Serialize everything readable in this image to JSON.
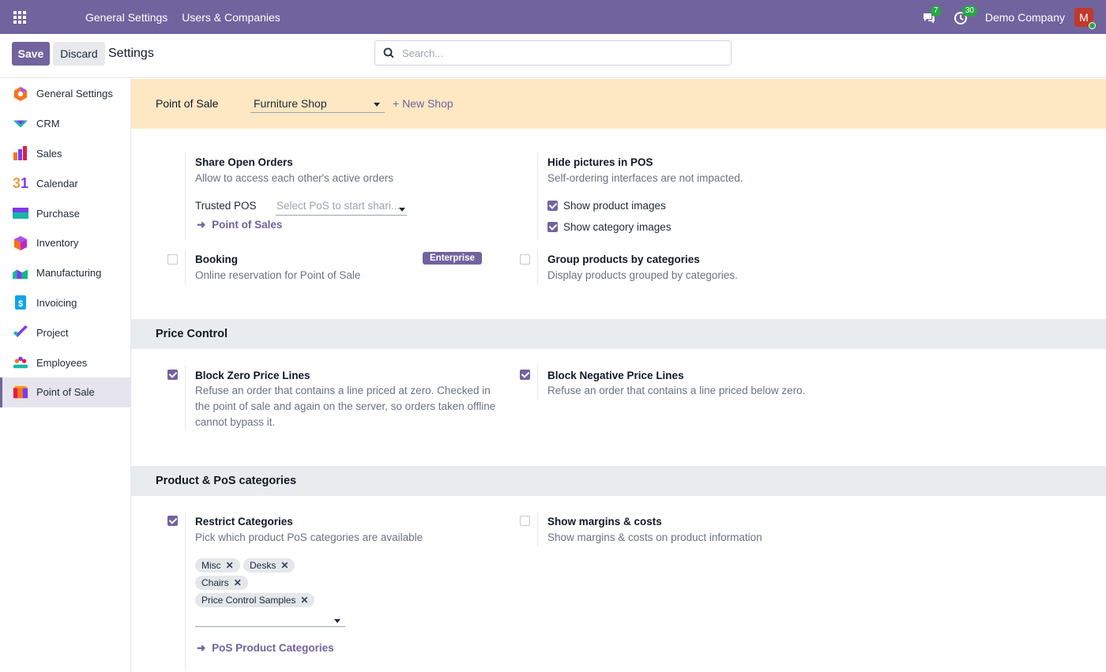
{
  "topbar": {
    "menu": [
      "General Settings",
      "Users & Companies"
    ],
    "messages_count": "7",
    "activities_count": "30",
    "company": "Demo Company",
    "avatar_letter": "M"
  },
  "control_panel": {
    "save_label": "Save",
    "discard_label": "Discard",
    "title": "Settings",
    "search_placeholder": "Search..."
  },
  "sidebar": {
    "items": [
      {
        "label": "General Settings",
        "icon": "general-settings-icon"
      },
      {
        "label": "CRM",
        "icon": "crm-icon"
      },
      {
        "label": "Sales",
        "icon": "sales-icon"
      },
      {
        "label": "Calendar",
        "icon": "calendar-icon"
      },
      {
        "label": "Purchase",
        "icon": "purchase-icon"
      },
      {
        "label": "Inventory",
        "icon": "inventory-icon"
      },
      {
        "label": "Manufacturing",
        "icon": "manufacturing-icon"
      },
      {
        "label": "Invoicing",
        "icon": "invoicing-icon"
      },
      {
        "label": "Project",
        "icon": "project-icon"
      },
      {
        "label": "Employees",
        "icon": "employees-icon"
      },
      {
        "label": "Point of Sale",
        "icon": "point-of-sale-icon"
      }
    ],
    "active_index": 10
  },
  "shop_bar": {
    "label": "Point of Sale",
    "selected_shop": "Furniture Shop",
    "new_shop": "+ New Shop"
  },
  "settings": {
    "share_open_orders": {
      "title": "Share Open Orders",
      "desc": "Allow to access each other's active orders",
      "trusted_label": "Trusted POS",
      "trusted_placeholder": "Select PoS to start shari...",
      "link": "Point of Sales"
    },
    "hide_pictures": {
      "title": "Hide pictures in POS",
      "desc": "Self-ordering interfaces are not impacted.",
      "option1": "Show product images",
      "option1_checked": true,
      "option2": "Show category images",
      "option2_checked": true
    },
    "booking": {
      "title": "Booking",
      "desc": "Online reservation for Point of Sale",
      "badge": "Enterprise",
      "checked": false
    },
    "group_products": {
      "title": "Group products by categories",
      "desc": "Display products grouped by categories.",
      "checked": false
    },
    "price_control": {
      "heading": "Price Control",
      "block_zero": {
        "title": "Block Zero Price Lines",
        "desc": [
          "Refuse an order that contains a line priced at zero. Checked in",
          "the point of sale and again on the server, so orders taken offline",
          "cannot bypass it."
        ],
        "checked": true
      },
      "block_negative": {
        "title": "Block Negative Price Lines",
        "desc": "Refuse an order that contains a line priced below zero.",
        "checked": true
      }
    },
    "categories": {
      "heading": "Product & PoS categories",
      "restrict": {
        "title": "Restrict Categories",
        "desc": "Pick which product PoS categories are available",
        "checked": true,
        "tags": [
          "Misc",
          "Desks",
          "Chairs",
          "Price Control Samples"
        ],
        "link": "PoS Product Categories"
      },
      "margins": {
        "title": "Show margins & costs",
        "desc": "Show margins & costs on product information",
        "checked": false
      }
    }
  },
  "colors": {
    "brand": "#71639e",
    "shop_bar_bg": "#fde8c3",
    "section_bg": "#e9ecef"
  }
}
